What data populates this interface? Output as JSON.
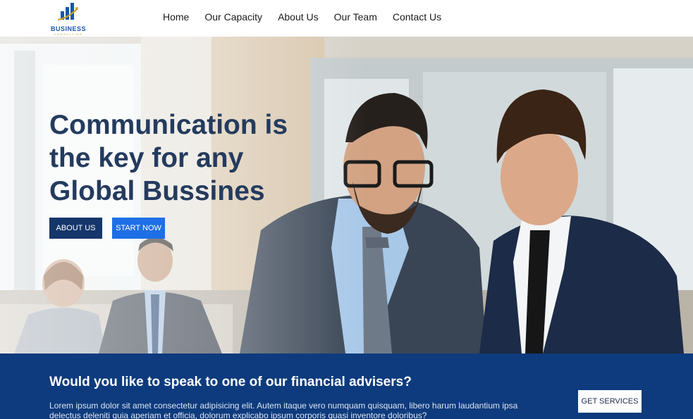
{
  "brand": {
    "name": "BUSINESS",
    "tagline": "CONSULTING",
    "icon": "bar-chart-arrow-logo",
    "colors": {
      "primary": "#1a56a8",
      "accent": "#c9a227"
    }
  },
  "nav": {
    "items": [
      {
        "label": "Home"
      },
      {
        "label": "Our Capacity"
      },
      {
        "label": "About Us"
      },
      {
        "label": "Our Team"
      },
      {
        "label": "Contact Us"
      }
    ]
  },
  "hero": {
    "title": "Communication is the key for any Global Bussines",
    "about_label": "ABOUT US",
    "start_label": "START NOW",
    "image": "two-businessmen-office-photo",
    "colors": {
      "title": "#243b5e",
      "about_button": "#15366b",
      "start_button": "#1e6fe6"
    }
  },
  "cta": {
    "title": "Would you like to speak to one of our financial advisers?",
    "text": "Lorem ipsum dolor sit amet consectetur adipisicing elit. Autem itaque vero numquam quisquam, libero harum laudantium ipsa delectus deleniti quia aperiam et officia, dolorum explicabo ipsum corporis quasi inventore doloribus?",
    "button_label": "GET SERVICES",
    "colors": {
      "background": "#0e3b7d"
    }
  }
}
